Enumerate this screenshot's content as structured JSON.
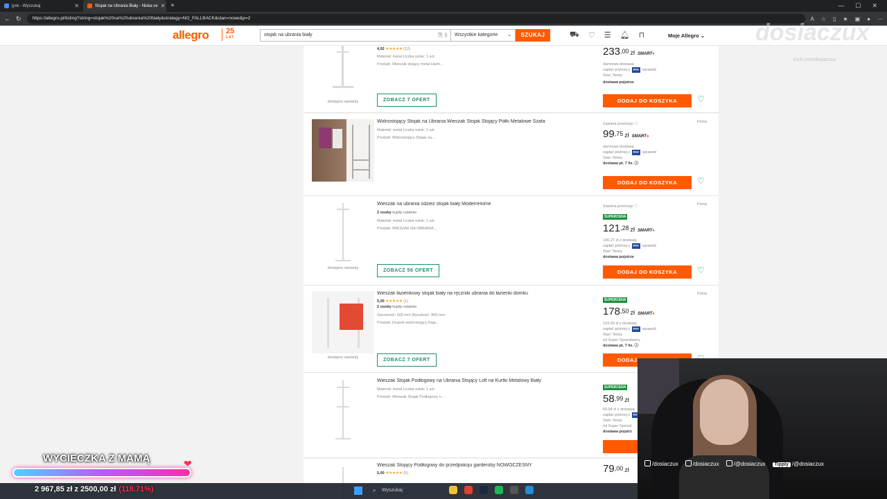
{
  "browser": {
    "tabs": [
      {
        "label": "jysk - Wyszukaj"
      },
      {
        "label": "Stojak na Ubrania Biały - Niska ce"
      }
    ],
    "url": "https://allegro.pl/listing?string=stojak%20na%20ubrania%20biały&strategy=NO_FALLBACK&stan=nowe&p=2"
  },
  "header": {
    "logo": "allegro",
    "logo_badge": "25",
    "logo_badge_sub": "LAT",
    "search_value": "stojak na ubrania biały",
    "category": "Wszystkie kategorie",
    "search_button": "SZUKAJ",
    "account": "Moje Allegro"
  },
  "listing": [
    {
      "rating": "4,92",
      "rating_count": "(12)",
      "params": "Materiał: metal   Liczba sztuk: 1 szt.",
      "product": "Produkt: Wieszak stojący metal Ha/m...",
      "variants": "dostępne warianty",
      "offers_button": "ZOBACZ 7 OFERT",
      "price_int": "233",
      "price_dec": ",00",
      "currency": "zł",
      "smart": "SMART",
      "line1": "darmowa dostawa",
      "pay_before": "zapłać później z",
      "pay_after": "sprawdź",
      "condition": "Stan: Nowy",
      "delivery": "dostawa pojutrze",
      "add_button": "DODAJ DO KOSZYKA"
    },
    {
      "title": "Wolnostojący Stojak na Ubrania Wieszak Stojak Stojący Półki Metalowe Szafa",
      "params": "Materiał: metal   Liczba sztuk: 1 szt.",
      "product": "Produkt: Wolnostojący Stojak na...",
      "promo": "Zawiera promocje ⓘ",
      "seller": "Firma",
      "price_int": "99",
      "price_dec": ",75",
      "currency": "zł",
      "smart": "SMART",
      "line1": "darmowa dostawa",
      "pay_before": "zapłać później z",
      "pay_after": "sprawdź",
      "condition": "Stan: Nowy",
      "delivery": "dostawa pt. 7 lis. ⓘ",
      "add_button": "DODAJ DO KOSZYKA"
    },
    {
      "title": "Wieszak na ubrania odzież stojak biały ModernHome",
      "bought": "2 osoby",
      "bought_suffix": "kupiły ostatnio",
      "params": "Materiał: metal   Liczba sztuk: 1 szt.",
      "product": "Produkt: WIESZAK NA UBRANIA...",
      "variants": "dostępne warianty",
      "offers_button": "ZOBACZ 56 OFERT",
      "promo": "Zawiera promocje ⓘ",
      "seller": "Firma",
      "badge": "SUPERCENA",
      "price_int": "121",
      "price_dec": ",28",
      "currency": "zł",
      "smart": "SMART",
      "line1": "136,27 zł z dostawą",
      "pay_before": "zapłać później z",
      "pay_after": "sprawdź",
      "condition": "Stan: Nowy",
      "delivery": "dostawa pojutrze",
      "add_button": "DODAJ DO KOSZYKA"
    },
    {
      "title": "Wieszak łazienkowy stojak biały na ręczniki ubrania do łazienki domku",
      "rating": "5,00",
      "rating_count": "(1)",
      "bought": "2 osoby",
      "bought_suffix": "kupiły ostatnio",
      "params": "Szerokość: 600 mm   Wysokość: 850 mm",
      "product": "Produkt: Drążek wolnostojący Kaja...",
      "variants": "dostępne warianty",
      "offers_button": "ZOBACZ 7 OFERT",
      "seller": "Firma",
      "badge": "SUPERCENA",
      "price_int": "178",
      "price_dec": ",50",
      "currency": "zł",
      "smart": "SMART",
      "line1": "193,49 zł z dostawą",
      "pay_before": "zapłać później z",
      "pay_after": "sprawdź",
      "condition": "Stan: Nowy",
      "seller_line": "od Super Sprzedawcy",
      "delivery": "dostawa pt. 7 lis. ⓘ",
      "add_button": "DODAJ DO KOSZYKA"
    },
    {
      "title": "Wieszak Stojak Podłogowy na Ubrania Stojący Loft na Kurtki Metalowy Biały",
      "params": "Materiał: metal   Liczba sztuk: 1 szt.",
      "product": "Produkt: Wieszak Stojak Podłogowy n...",
      "badge": "SUPERCENA",
      "price_int": "58",
      "price_dec": ",99",
      "currency": "zł",
      "line1": "69,94 zł z dostawą",
      "pay_before": "zapłać później z",
      "condition": "Stan: Nowy",
      "seller_line": "od Super Sprzed",
      "delivery": "dostawa pojutrz",
      "add_button": "DODAJ"
    },
    {
      "title": "Wieszak Stojący Podłogowy do przedpokoju garderoby NOWOCZESNY",
      "rating": "5,00",
      "rating_count": "(5)",
      "price_int": "79",
      "price_dec": ",00",
      "currency": "zł"
    }
  ],
  "overlay": {
    "watermark": "dosiaczux",
    "watermark_sub": "Kick.com/dosiaczux",
    "goal_title": "WYCIECZKA Z MAMĄ",
    "goal_amount": "2 967,85 zł z 2500,00 zł",
    "goal_percent": "(118.71%)",
    "goal_progress": 1.0,
    "socials": [
      "/dosiaczux",
      "/dosiaczux",
      "/@dosiaczux",
      "Tipply",
      "/@dosiaczux"
    ]
  },
  "taskbar": {
    "search": "Wyszukaj"
  },
  "colors": {
    "allegro_orange": "#ff5a00",
    "green": "#1a8d6e",
    "supercena": "#1a8f3c"
  }
}
